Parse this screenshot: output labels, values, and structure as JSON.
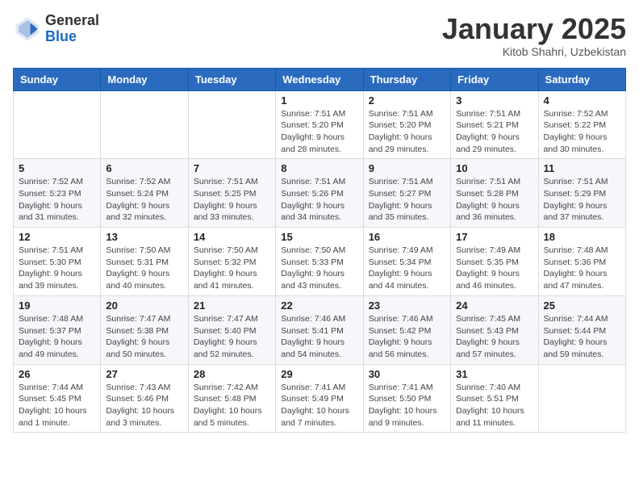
{
  "header": {
    "logo_general": "General",
    "logo_blue": "Blue",
    "month_title": "January 2025",
    "subtitle": "Kitob Shahri, Uzbekistan"
  },
  "weekdays": [
    "Sunday",
    "Monday",
    "Tuesday",
    "Wednesday",
    "Thursday",
    "Friday",
    "Saturday"
  ],
  "weeks": [
    [
      {
        "date": "",
        "sunrise": "",
        "sunset": "",
        "daylight": ""
      },
      {
        "date": "",
        "sunrise": "",
        "sunset": "",
        "daylight": ""
      },
      {
        "date": "",
        "sunrise": "",
        "sunset": "",
        "daylight": ""
      },
      {
        "date": "1",
        "sunrise": "Sunrise: 7:51 AM",
        "sunset": "Sunset: 5:20 PM",
        "daylight": "Daylight: 9 hours and 28 minutes."
      },
      {
        "date": "2",
        "sunrise": "Sunrise: 7:51 AM",
        "sunset": "Sunset: 5:20 PM",
        "daylight": "Daylight: 9 hours and 29 minutes."
      },
      {
        "date": "3",
        "sunrise": "Sunrise: 7:51 AM",
        "sunset": "Sunset: 5:21 PM",
        "daylight": "Daylight: 9 hours and 29 minutes."
      },
      {
        "date": "4",
        "sunrise": "Sunrise: 7:52 AM",
        "sunset": "Sunset: 5:22 PM",
        "daylight": "Daylight: 9 hours and 30 minutes."
      }
    ],
    [
      {
        "date": "5",
        "sunrise": "Sunrise: 7:52 AM",
        "sunset": "Sunset: 5:23 PM",
        "daylight": "Daylight: 9 hours and 31 minutes."
      },
      {
        "date": "6",
        "sunrise": "Sunrise: 7:52 AM",
        "sunset": "Sunset: 5:24 PM",
        "daylight": "Daylight: 9 hours and 32 minutes."
      },
      {
        "date": "7",
        "sunrise": "Sunrise: 7:51 AM",
        "sunset": "Sunset: 5:25 PM",
        "daylight": "Daylight: 9 hours and 33 minutes."
      },
      {
        "date": "8",
        "sunrise": "Sunrise: 7:51 AM",
        "sunset": "Sunset: 5:26 PM",
        "daylight": "Daylight: 9 hours and 34 minutes."
      },
      {
        "date": "9",
        "sunrise": "Sunrise: 7:51 AM",
        "sunset": "Sunset: 5:27 PM",
        "daylight": "Daylight: 9 hours and 35 minutes."
      },
      {
        "date": "10",
        "sunrise": "Sunrise: 7:51 AM",
        "sunset": "Sunset: 5:28 PM",
        "daylight": "Daylight: 9 hours and 36 minutes."
      },
      {
        "date": "11",
        "sunrise": "Sunrise: 7:51 AM",
        "sunset": "Sunset: 5:29 PM",
        "daylight": "Daylight: 9 hours and 37 minutes."
      }
    ],
    [
      {
        "date": "12",
        "sunrise": "Sunrise: 7:51 AM",
        "sunset": "Sunset: 5:30 PM",
        "daylight": "Daylight: 9 hours and 39 minutes."
      },
      {
        "date": "13",
        "sunrise": "Sunrise: 7:50 AM",
        "sunset": "Sunset: 5:31 PM",
        "daylight": "Daylight: 9 hours and 40 minutes."
      },
      {
        "date": "14",
        "sunrise": "Sunrise: 7:50 AM",
        "sunset": "Sunset: 5:32 PM",
        "daylight": "Daylight: 9 hours and 41 minutes."
      },
      {
        "date": "15",
        "sunrise": "Sunrise: 7:50 AM",
        "sunset": "Sunset: 5:33 PM",
        "daylight": "Daylight: 9 hours and 43 minutes."
      },
      {
        "date": "16",
        "sunrise": "Sunrise: 7:49 AM",
        "sunset": "Sunset: 5:34 PM",
        "daylight": "Daylight: 9 hours and 44 minutes."
      },
      {
        "date": "17",
        "sunrise": "Sunrise: 7:49 AM",
        "sunset": "Sunset: 5:35 PM",
        "daylight": "Daylight: 9 hours and 46 minutes."
      },
      {
        "date": "18",
        "sunrise": "Sunrise: 7:48 AM",
        "sunset": "Sunset: 5:36 PM",
        "daylight": "Daylight: 9 hours and 47 minutes."
      }
    ],
    [
      {
        "date": "19",
        "sunrise": "Sunrise: 7:48 AM",
        "sunset": "Sunset: 5:37 PM",
        "daylight": "Daylight: 9 hours and 49 minutes."
      },
      {
        "date": "20",
        "sunrise": "Sunrise: 7:47 AM",
        "sunset": "Sunset: 5:38 PM",
        "daylight": "Daylight: 9 hours and 50 minutes."
      },
      {
        "date": "21",
        "sunrise": "Sunrise: 7:47 AM",
        "sunset": "Sunset: 5:40 PM",
        "daylight": "Daylight: 9 hours and 52 minutes."
      },
      {
        "date": "22",
        "sunrise": "Sunrise: 7:46 AM",
        "sunset": "Sunset: 5:41 PM",
        "daylight": "Daylight: 9 hours and 54 minutes."
      },
      {
        "date": "23",
        "sunrise": "Sunrise: 7:46 AM",
        "sunset": "Sunset: 5:42 PM",
        "daylight": "Daylight: 9 hours and 56 minutes."
      },
      {
        "date": "24",
        "sunrise": "Sunrise: 7:45 AM",
        "sunset": "Sunset: 5:43 PM",
        "daylight": "Daylight: 9 hours and 57 minutes."
      },
      {
        "date": "25",
        "sunrise": "Sunrise: 7:44 AM",
        "sunset": "Sunset: 5:44 PM",
        "daylight": "Daylight: 9 hours and 59 minutes."
      }
    ],
    [
      {
        "date": "26",
        "sunrise": "Sunrise: 7:44 AM",
        "sunset": "Sunset: 5:45 PM",
        "daylight": "Daylight: 10 hours and 1 minute."
      },
      {
        "date": "27",
        "sunrise": "Sunrise: 7:43 AM",
        "sunset": "Sunset: 5:46 PM",
        "daylight": "Daylight: 10 hours and 3 minutes."
      },
      {
        "date": "28",
        "sunrise": "Sunrise: 7:42 AM",
        "sunset": "Sunset: 5:48 PM",
        "daylight": "Daylight: 10 hours and 5 minutes."
      },
      {
        "date": "29",
        "sunrise": "Sunrise: 7:41 AM",
        "sunset": "Sunset: 5:49 PM",
        "daylight": "Daylight: 10 hours and 7 minutes."
      },
      {
        "date": "30",
        "sunrise": "Sunrise: 7:41 AM",
        "sunset": "Sunset: 5:50 PM",
        "daylight": "Daylight: 10 hours and 9 minutes."
      },
      {
        "date": "31",
        "sunrise": "Sunrise: 7:40 AM",
        "sunset": "Sunset: 5:51 PM",
        "daylight": "Daylight: 10 hours and 11 minutes."
      },
      {
        "date": "",
        "sunrise": "",
        "sunset": "",
        "daylight": ""
      }
    ]
  ]
}
